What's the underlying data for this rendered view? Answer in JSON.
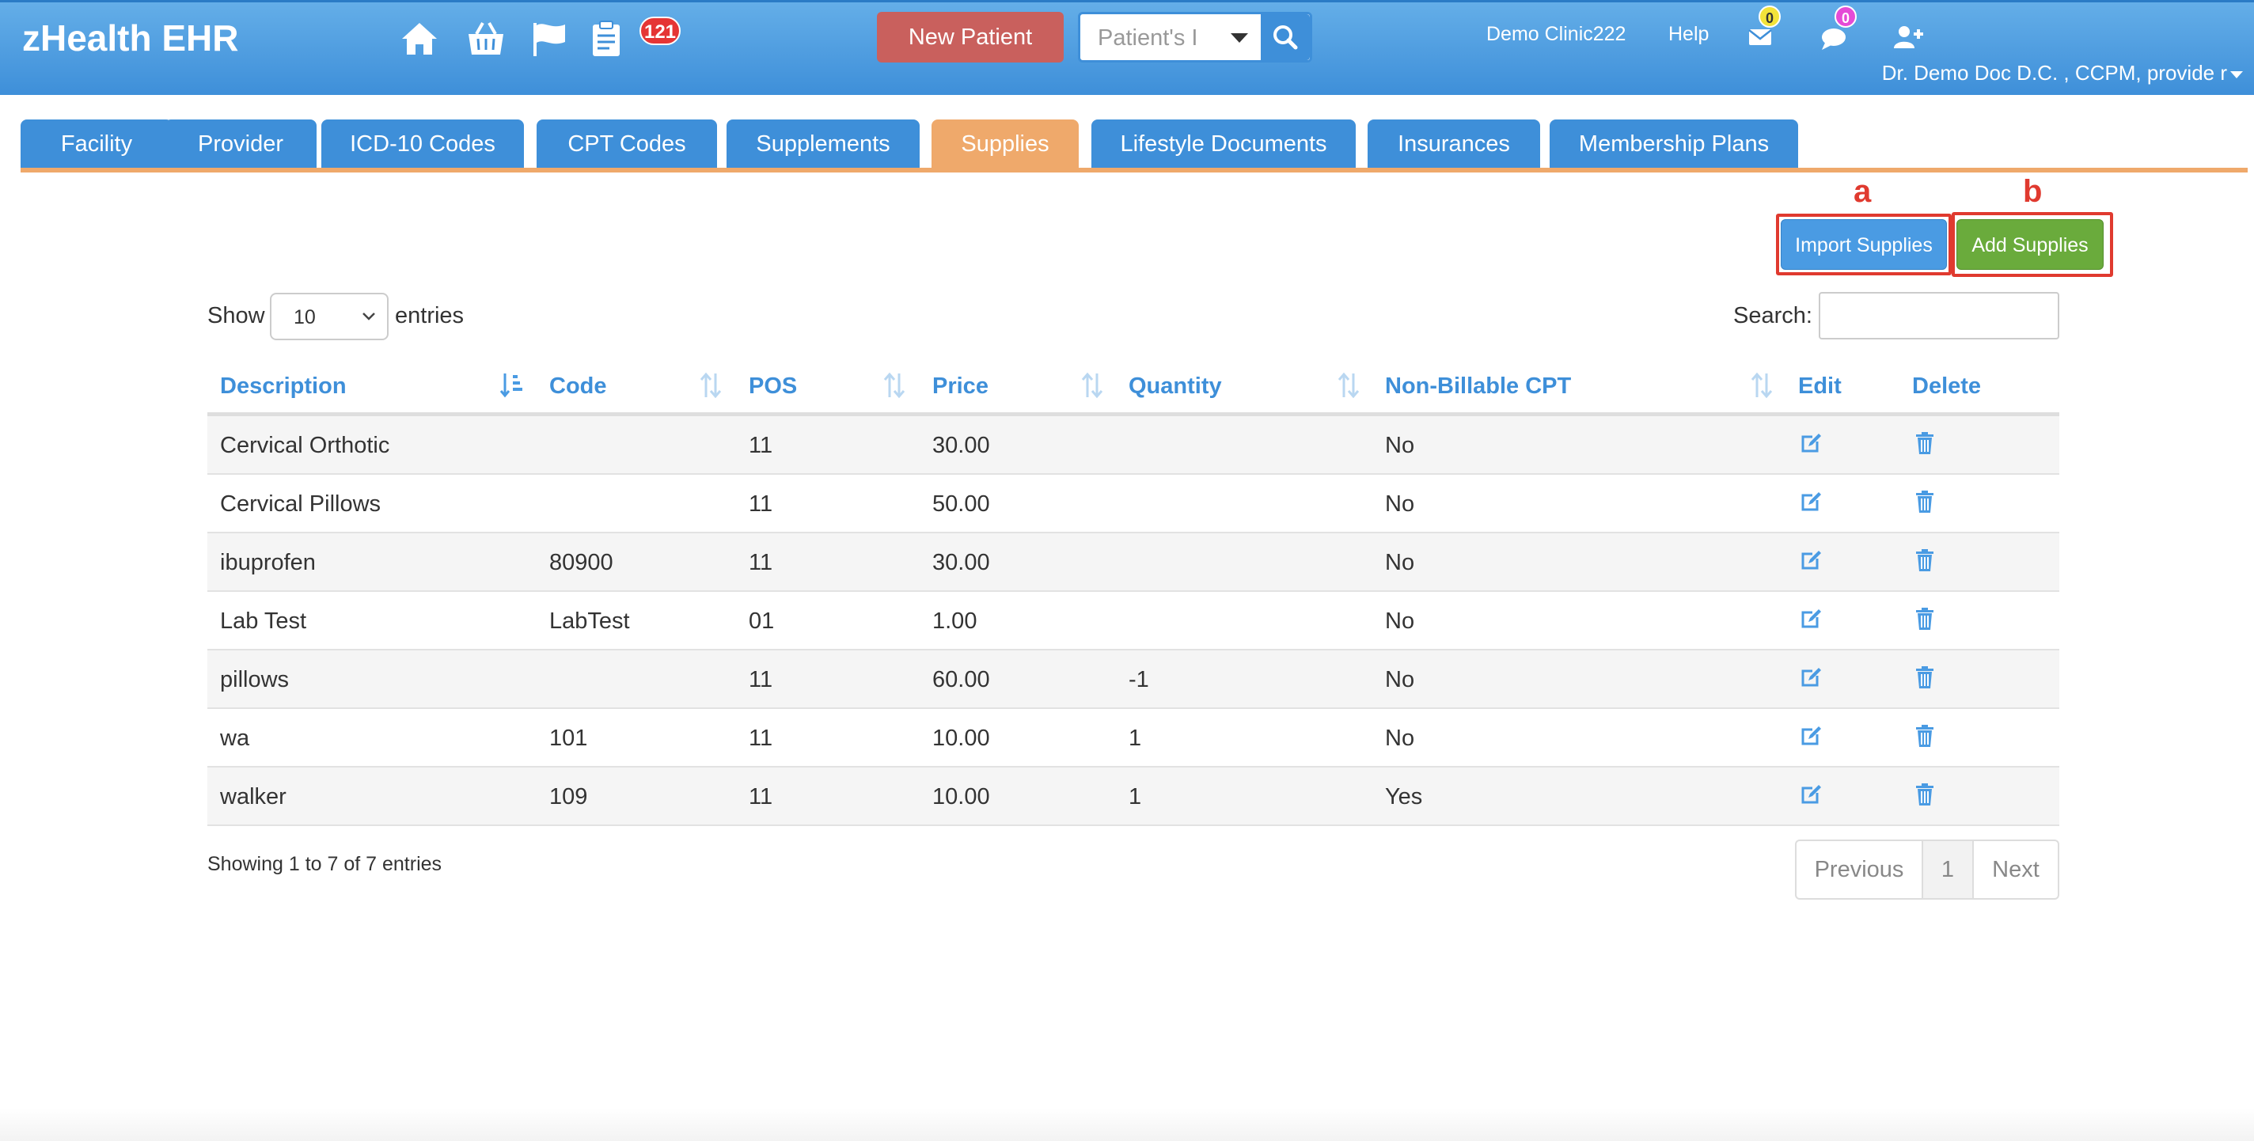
{
  "app": {
    "brand": "zHealth EHR",
    "task_badge": "121",
    "new_patient_label": "New Patient",
    "patient_search_placeholder": "Patient's I",
    "clinic": "Demo Clinic222",
    "help": "Help",
    "mail_count": "0",
    "chat_count": "0",
    "user": "Dr. Demo Doc D.C. , CCPM, provide r",
    "colors": {
      "primary": "#3e8fd9",
      "accent": "#efa96b",
      "danger": "#c9605d",
      "success": "#6aab3c"
    },
    "icons": [
      "home-icon",
      "basket-icon",
      "flag-icon",
      "clipboard-icon",
      "search-icon",
      "envelope-icon",
      "chat-icon",
      "add-user-icon"
    ]
  },
  "tabs": [
    {
      "label": "Facility"
    },
    {
      "label": "Provider"
    },
    {
      "label": "ICD-10 Codes"
    },
    {
      "label": "CPT Codes"
    },
    {
      "label": "Supplements"
    },
    {
      "label": "Supplies",
      "active": true
    },
    {
      "label": "Lifestyle Documents"
    },
    {
      "label": "Insurances"
    },
    {
      "label": "Membership Plans"
    }
  ],
  "actions": {
    "label_a": "a",
    "label_b": "b",
    "import_label": "Import Supplies",
    "add_label": "Add Supplies"
  },
  "table_controls": {
    "show": "Show",
    "page_length": "10",
    "entries": "entries",
    "search": "Search:"
  },
  "table": {
    "columns": [
      "Description",
      "Code",
      "POS",
      "Price",
      "Quantity",
      "Non-Billable CPT",
      "Edit",
      "Delete"
    ],
    "rows": [
      [
        "Cervical Orthotic",
        "",
        "11",
        "30.00",
        "",
        "No"
      ],
      [
        "Cervical Pillows",
        "",
        "11",
        "50.00",
        "",
        "No"
      ],
      [
        "ibuprofen",
        "80900",
        "11",
        "30.00",
        "",
        "No"
      ],
      [
        "Lab Test",
        "LabTest",
        "01",
        "1.00",
        "",
        "No"
      ],
      [
        "pillows",
        "",
        "11",
        "60.00",
        "-1",
        "No"
      ],
      [
        "wa",
        "101",
        "11",
        "10.00",
        "1",
        "No"
      ],
      [
        "walker",
        "109",
        "11",
        "10.00",
        "1",
        "Yes"
      ]
    ]
  },
  "footer": {
    "info": "Showing 1 to 7 of 7 entries",
    "previous": "Previous",
    "page": "1",
    "next": "Next"
  }
}
